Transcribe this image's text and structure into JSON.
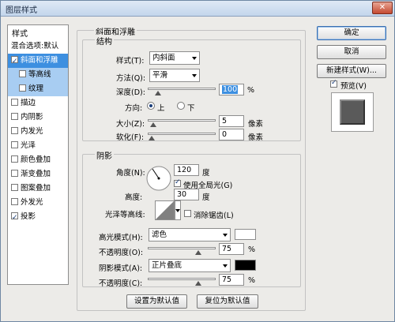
{
  "window": {
    "title": "图层样式",
    "close_glyph": "✕"
  },
  "style_list": {
    "header": "样式",
    "items": [
      {
        "label": "混合选项:默认",
        "checkbox": false,
        "checked": false
      },
      {
        "label": "斜面和浮雕",
        "checkbox": true,
        "checked": true
      },
      {
        "label": "等高线",
        "checkbox": true,
        "checked": false
      },
      {
        "label": "纹理",
        "checkbox": true,
        "checked": false
      },
      {
        "label": "描边",
        "checkbox": true,
        "checked": false
      },
      {
        "label": "内阴影",
        "checkbox": true,
        "checked": false
      },
      {
        "label": "内发光",
        "checkbox": true,
        "checked": false
      },
      {
        "label": "光泽",
        "checkbox": true,
        "checked": false
      },
      {
        "label": "颜色叠加",
        "checkbox": true,
        "checked": false
      },
      {
        "label": "渐变叠加",
        "checkbox": true,
        "checked": false
      },
      {
        "label": "图案叠加",
        "checkbox": true,
        "checked": false
      },
      {
        "label": "外发光",
        "checkbox": true,
        "checked": false
      },
      {
        "label": "投影",
        "checkbox": true,
        "checked": true
      }
    ]
  },
  "bevel": {
    "title": "斜面和浮雕",
    "structure": {
      "title": "结构",
      "style_label": "样式(T):",
      "style_value": "内斜面",
      "method_label": "方法(Q):",
      "method_value": "平滑",
      "depth_label": "深度(D):",
      "depth_value": "100",
      "depth_unit": "%",
      "depth_level": 0.1,
      "direction_label": "方向:",
      "dir_up": "上",
      "dir_down": "下",
      "size_label": "大小(Z):",
      "size_value": "5",
      "size_unit": "像素",
      "size_level": 0.02,
      "soften_label": "软化(F):",
      "soften_value": "0",
      "soften_unit": "像素",
      "soften_level": 0.0
    },
    "shading": {
      "title": "阴影",
      "angle_label": "角度(N):",
      "angle_value": "120",
      "angle_unit": "度",
      "global_light_label": "使用全局光(G)",
      "altitude_label": "高度:",
      "altitude_value": "30",
      "altitude_unit": "度",
      "gloss_label": "光泽等高线:",
      "antialias_label": "消除锯齿(L)",
      "highlight_mode_label": "高光模式(H):",
      "highlight_mode_value": "滤色",
      "highlight_color": "#ffffff",
      "highlight_opacity_label": "不透明度(O):",
      "highlight_opacity_value": "75",
      "highlight_opacity_unit": "%",
      "highlight_opacity_level": 0.75,
      "shadow_mode_label": "阴影模式(A):",
      "shadow_mode_value": "正片叠底",
      "shadow_color": "#000000",
      "shadow_opacity_label": "不透明度(C):",
      "shadow_opacity_value": "75",
      "shadow_opacity_unit": "%",
      "shadow_opacity_level": 0.75
    },
    "set_default": "设置为默认值",
    "reset_default": "复位为默认值"
  },
  "actions": {
    "ok": "确定",
    "cancel": "取消",
    "new_style": "新建样式(W)...",
    "preview": "预览(V)"
  }
}
